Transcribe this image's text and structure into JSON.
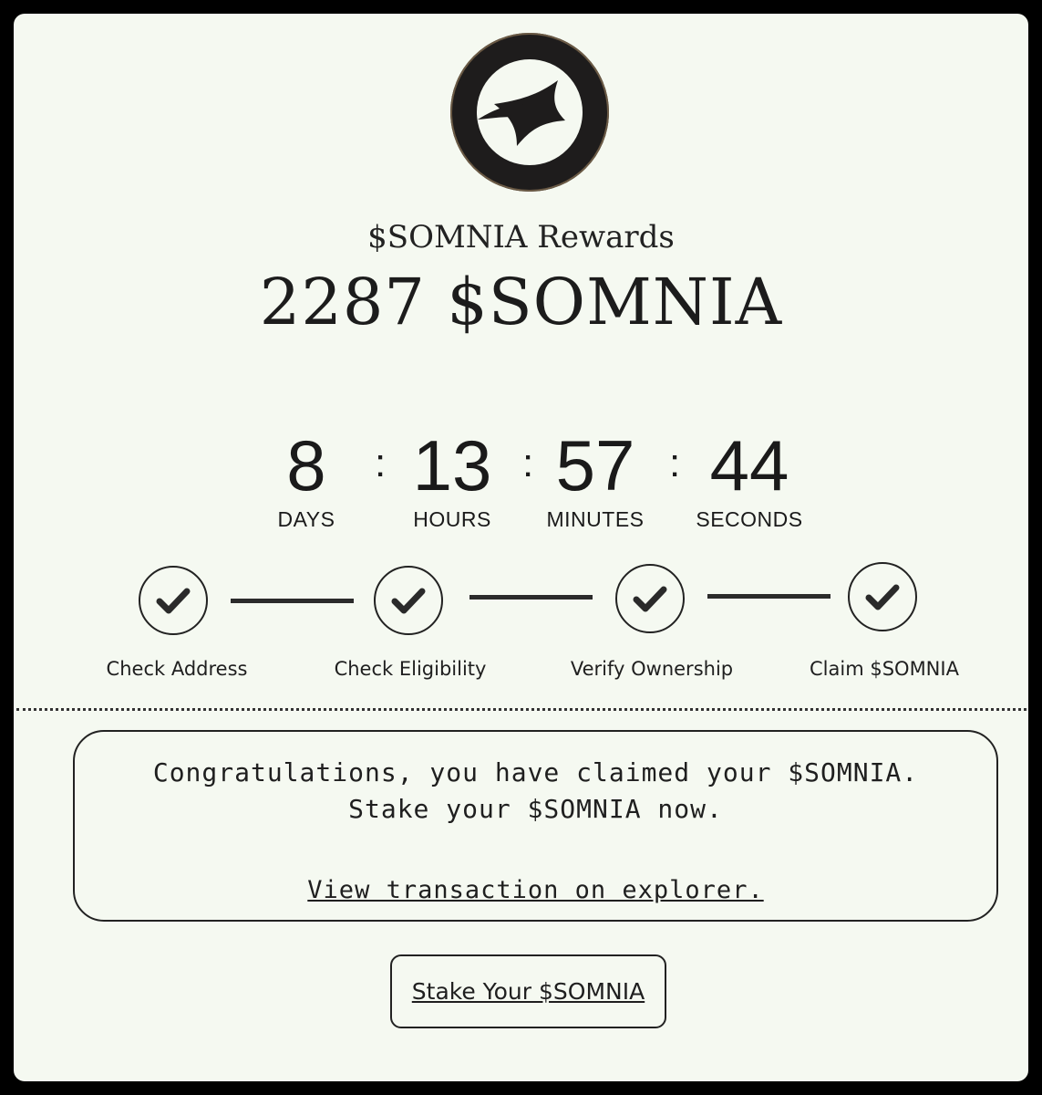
{
  "header": {
    "logo_icon": "somnia-star-logo",
    "rewards_label": "$SOMNIA Rewards",
    "amount": "2287 $SOMNIA"
  },
  "countdown": {
    "days": {
      "value": "8",
      "label": "DAYS"
    },
    "hours": {
      "value": "13",
      "label": "HOURS"
    },
    "minutes": {
      "value": "57",
      "label": "MINUTES"
    },
    "seconds": {
      "value": "44",
      "label": "SECONDS"
    },
    "separator": ":"
  },
  "steps": [
    {
      "label": "Check Address",
      "icon": "check-icon",
      "done": true
    },
    {
      "label": "Check Eligibility",
      "icon": "check-icon",
      "done": true
    },
    {
      "label": "Verify Ownership",
      "icon": "check-icon",
      "done": true
    },
    {
      "label": "Claim $SOMNIA",
      "icon": "check-icon",
      "done": true
    }
  ],
  "message": {
    "line1": "Congratulations, you have claimed your $SOMNIA.",
    "line2": "Stake your $SOMNIA now.",
    "explorer_link": "View transaction on explorer."
  },
  "actions": {
    "stake_label": "Stake Your $SOMNIA"
  },
  "colors": {
    "card_background": "#f5f9f1",
    "outer_background": "#000000",
    "ink": "#1e1c1c"
  }
}
